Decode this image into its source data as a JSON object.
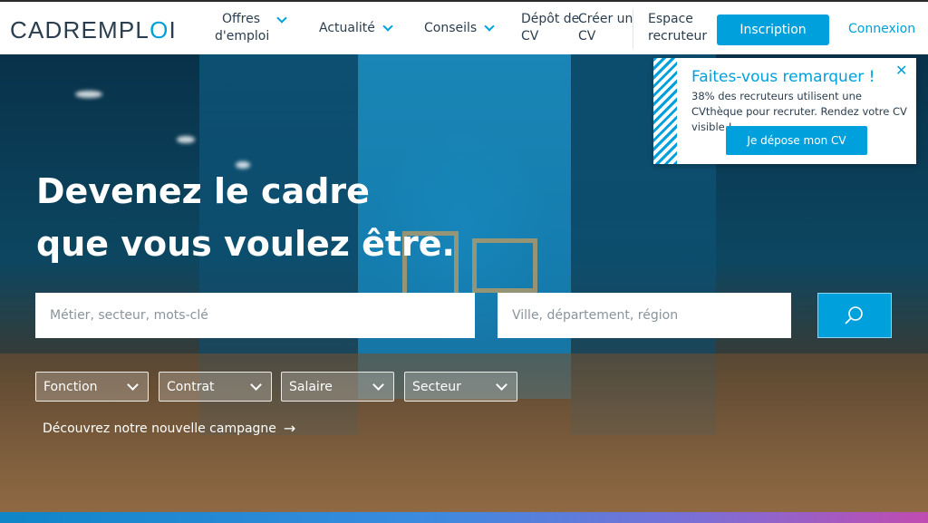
{
  "header": {
    "logo": "CADREMPLOI",
    "nav": [
      {
        "line1": "Offres",
        "line2": "d'emploi",
        "has_dropdown": true
      },
      {
        "line1": "Actualité",
        "line2": "",
        "has_dropdown": true
      },
      {
        "line1": "Conseils",
        "line2": "",
        "has_dropdown": true
      },
      {
        "line1": "Dépôt de",
        "line2": "CV",
        "has_dropdown": false
      },
      {
        "line1": "Créer un",
        "line2": "CV",
        "has_dropdown": false
      },
      {
        "line1": "Espace",
        "line2": "recruteur",
        "has_dropdown": false
      }
    ],
    "inscription_label": "Inscription",
    "connexion_label": "Connexion"
  },
  "hero": {
    "headline_line1": "Devenez le cadre",
    "headline_line2": "que vous voulez être.",
    "search": {
      "keywords_placeholder": "Métier, secteur, mots-clé",
      "location_placeholder": "Ville, département, région",
      "button_icon": "search-icon"
    },
    "filters": [
      "Fonction",
      "Contrat",
      "Salaire",
      "Secteur"
    ],
    "campaign_link": "Découvrez notre nouvelle campagne",
    "campaign_icon": "arrow-right-icon"
  },
  "popup": {
    "title": "Faites-vous remarquer !",
    "text": "38% des recruteurs utilisent une CVthèque pour recruter. Rendez votre CV visible !",
    "button_label": "Je dépose mon CV",
    "close_icon": "close-icon"
  },
  "colors": {
    "brand_blue": "#00a0dc",
    "text_dark": "#2a3e4f",
    "white": "#ffffff"
  }
}
